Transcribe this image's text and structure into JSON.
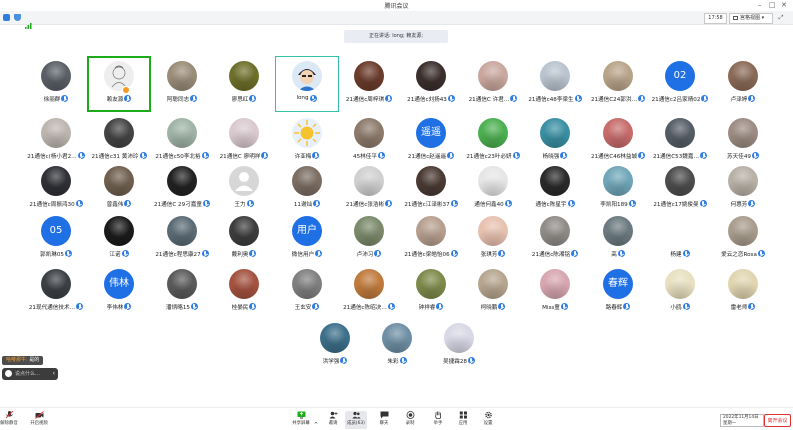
{
  "window": {
    "title": "腾讯会议"
  },
  "toolbar_top": {
    "time": "17:58",
    "view_label": "宫格视图"
  },
  "speaking_banner": "正在讲话: long; 赖友源;",
  "participants": [
    {
      "name": "徐丽群",
      "style": "photo",
      "color": "#5a5f66"
    },
    {
      "name": "赖友源",
      "style": "sketch",
      "color": "#eeeeee",
      "highlight": "green",
      "host": true
    },
    {
      "name": "阿聪同志",
      "style": "photo",
      "color": "#9a8c78"
    },
    {
      "name": "廖思红",
      "style": "photo",
      "color": "#6d6f2a"
    },
    {
      "name": "long",
      "style": "cartoon",
      "color": "#2e74c9",
      "highlight": "teal"
    },
    {
      "name": "21通信c周梓琪",
      "style": "photo",
      "color": "#6b3b2c"
    },
    {
      "name": "21通信c刘扬43",
      "style": "photo",
      "color": "#3b2f2d"
    },
    {
      "name": "21通信C 许君…",
      "style": "photo",
      "color": "#c9a79e"
    },
    {
      "name": "21通信c48李梁生",
      "style": "photo",
      "color": "#b9c4cf"
    },
    {
      "name": "21通信C24郭洪…",
      "style": "photo",
      "color": "#b8a48a"
    },
    {
      "name": "21通信c2吕家晴02",
      "style": "text",
      "text": "02",
      "color": "#1f6fe5"
    },
    {
      "name": "卢泽婷",
      "style": "photo",
      "color": "#8a6a57"
    },
    {
      "name": "21通信c(杨小君2…",
      "style": "photo",
      "color": "#bdb6b0"
    },
    {
      "name": "21通信c31 黄沛玲",
      "style": "photo",
      "color": "#444444"
    },
    {
      "name": "21通信c50李北裕",
      "style": "photo",
      "color": "#9fb3a6"
    },
    {
      "name": "21通信C 廖明祥",
      "style": "photo",
      "color": "#d9c9cf"
    },
    {
      "name": "许亚梅",
      "style": "sun",
      "color": "#f4c430"
    },
    {
      "name": "45林佳平",
      "style": "photo",
      "color": "#8c7a6b"
    },
    {
      "name": "21通信c赵遥遥",
      "style": "text",
      "text": "遥遥",
      "color": "#1f6fe5"
    },
    {
      "name": "21通信c23叶必妍",
      "style": "photo",
      "color": "#4caf50"
    },
    {
      "name": "杨晓强",
      "style": "photo",
      "color": "#3a8fa3"
    },
    {
      "name": "21通信C46林益城",
      "style": "photo",
      "color": "#c76b6b"
    },
    {
      "name": "21通信C53魏嘉…",
      "style": "photo",
      "color": "#555d66"
    },
    {
      "name": "苏天佳49",
      "style": "photo",
      "color": "#9c8c82"
    },
    {
      "name": "21通信c周振鸿30",
      "style": "photo",
      "color": "#2f3136"
    },
    {
      "name": "曾鑫伟",
      "style": "photo",
      "color": "#6f5f4f"
    },
    {
      "name": "21通信C 29刁嘉童",
      "style": "photo",
      "color": "#222222"
    },
    {
      "name": "王力",
      "style": "default",
      "color": "#d7d7d7"
    },
    {
      "name": "11谢灿",
      "style": "photo",
      "color": "#7b6d62"
    },
    {
      "name": "21通信c张浩彬",
      "style": "photo",
      "color": "#d0d0d0"
    },
    {
      "name": "21通信c江泽彬37",
      "style": "photo",
      "color": "#4a3a33"
    },
    {
      "name": "通信何鑫40",
      "style": "photo",
      "color": "#e6e6e6"
    },
    {
      "name": "通信c陈星宇",
      "style": "photo",
      "color": "#2a2a2a"
    },
    {
      "name": "李凯阳189",
      "style": "photo",
      "color": "#6fa6b8"
    },
    {
      "name": "21通信c17姚俊曼",
      "style": "photo",
      "color": "#4d4d4d"
    },
    {
      "name": "何惠芳",
      "style": "photo",
      "color": "#b7b0a6"
    },
    {
      "name": "郭凯琳05",
      "style": "text",
      "text": "05",
      "color": "#1f6fe5"
    },
    {
      "name": "江诺",
      "style": "photo",
      "color": "#1b1b1b"
    },
    {
      "name": "21通信c程思康27",
      "style": "photo",
      "color": "#5b6b75"
    },
    {
      "name": "戴利奥",
      "style": "photo",
      "color": "#3d3d3d"
    },
    {
      "name": "微信用户",
      "style": "text",
      "text": "用户",
      "color": "#1f6fe5"
    },
    {
      "name": "卢沛习",
      "style": "photo",
      "color": "#7a8a6a"
    },
    {
      "name": "21通信c梁皓怡06",
      "style": "photo",
      "color": "#b79f8f"
    },
    {
      "name": "张琪芳",
      "style": "photo",
      "color": "#e7c1b0"
    },
    {
      "name": "21通信c陈湘铭",
      "style": "photo",
      "color": "#8f8c88"
    },
    {
      "name": "高",
      "style": "photo",
      "color": "#6b7a80"
    },
    {
      "name": "杨建",
      "style": "empty"
    },
    {
      "name": "爱云之恋Rosa",
      "style": "photo",
      "color": "#a89c8c"
    },
    {
      "name": "21现代通信技术…",
      "style": "photo",
      "color": "#3c3f44"
    },
    {
      "name": "李伟林",
      "style": "text",
      "text": "伟林",
      "color": "#1f6fe5"
    },
    {
      "name": "潘炳略15",
      "style": "photo",
      "color": "#5a5a5a"
    },
    {
      "name": "桂晏民",
      "style": "photo",
      "color": "#a4523f"
    },
    {
      "name": "王玄安",
      "style": "photo",
      "color": "#7f7f7f"
    },
    {
      "name": "21通信c陈昭决…",
      "style": "photo",
      "color": "#c07a3c"
    },
    {
      "name": "钟祥睿",
      "style": "photo",
      "color": "#7d8a4a"
    },
    {
      "name": "柯晓鹏",
      "style": "photo",
      "color": "#b6a58f"
    },
    {
      "name": "Miss童",
      "style": "photo",
      "color": "#d7a6b0"
    },
    {
      "name": "路春辉",
      "style": "text",
      "text": "春辉",
      "color": "#1f6fe5"
    },
    {
      "name": "小鸥",
      "style": "photo",
      "color": "#e8e0c0"
    },
    {
      "name": "雷老师",
      "style": "photo",
      "color": "#e0d5b0"
    },
    {
      "name": "洪学强",
      "style": "photo",
      "color": "#3c6f8a"
    },
    {
      "name": "朱彩",
      "style": "photo",
      "color": "#6f8fa5"
    },
    {
      "name": "吴捷霖28",
      "style": "photo",
      "color": "#d8d8e6"
    }
  ],
  "chat": {
    "sender": "哈喽那牛:",
    "message": "是的",
    "input_placeholder": "说点什么…"
  },
  "bottom_bar": {
    "unmute": "解除静音",
    "video": "开启视频",
    "share_screen": "共享屏幕",
    "invite": "邀请",
    "manage_members": "成员(63)",
    "chat": "聊天",
    "record": "录制",
    "raise_hand": "举手",
    "apps": "应用",
    "settings": "设置"
  },
  "datetime": {
    "date": "2022年11月14日",
    "weekday": "星期一"
  },
  "leave_label": "离开会议"
}
